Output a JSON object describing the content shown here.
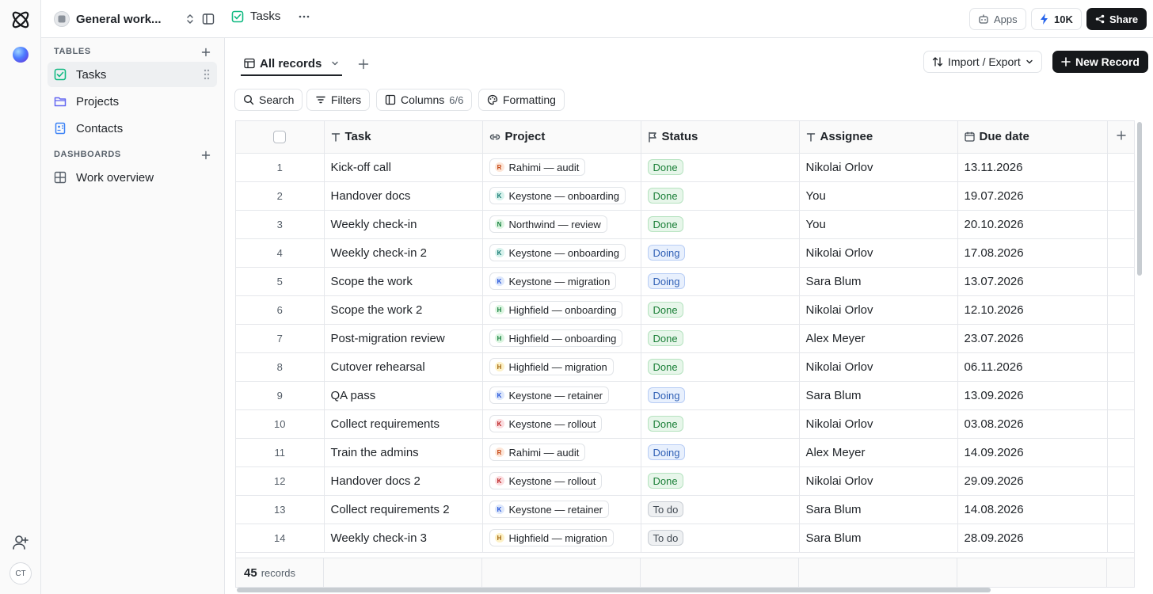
{
  "workspace": {
    "name": "General work..."
  },
  "topbar": {
    "page_title": "Tasks",
    "apps_label": "Apps",
    "credits_label": "10K",
    "share_label": "Share"
  },
  "rail": {
    "avatar_initials": "CT"
  },
  "sidebar": {
    "tables_heading": "TABLES",
    "tables": [
      {
        "label": "Tasks",
        "icon": "checkbox-icon",
        "color": "#10b981"
      },
      {
        "label": "Projects",
        "icon": "folder-icon",
        "color": "#6366f1"
      },
      {
        "label": "Contacts",
        "icon": "contact-book-icon",
        "color": "#3b82f6"
      }
    ],
    "dashboards_heading": "DASHBOARDS",
    "dashboards": [
      {
        "label": "Work overview",
        "icon": "dashboard-grid-icon"
      }
    ]
  },
  "view": {
    "tab_label": "All records"
  },
  "actions": {
    "import_export_label": "Import / Export",
    "new_record_label": "New Record"
  },
  "toolbar": {
    "search_label": "Search",
    "filters_label": "Filters",
    "columns_label": "Columns",
    "columns_count": "6/6",
    "formatting_label": "Formatting"
  },
  "table": {
    "columns": [
      "Task",
      "Project",
      "Status",
      "Assignee",
      "Due date"
    ],
    "rows": [
      {
        "num": "1",
        "task": "Kick-off call",
        "project": "Rahimi — audit",
        "project_initial": "R",
        "status": "Done",
        "assignee": "Nikolai Orlov",
        "due": "13.11.2026"
      },
      {
        "num": "2",
        "task": "Handover docs",
        "project": "Keystone — onboarding",
        "project_initial": "K",
        "status": "Done",
        "assignee": "You",
        "due": "19.07.2026"
      },
      {
        "num": "3",
        "task": "Weekly check-in",
        "project": "Northwind — review",
        "project_initial": "N",
        "status": "Done",
        "assignee": "You",
        "due": "20.10.2026"
      },
      {
        "num": "4",
        "task": "Weekly check-in 2",
        "project": "Keystone — onboarding",
        "project_initial": "K",
        "status": "Doing",
        "assignee": "Nikolai Orlov",
        "due": "17.08.2026"
      },
      {
        "num": "5",
        "task": "Scope the work",
        "project": "Keystone — migration",
        "project_initial": "K",
        "status": "Doing",
        "assignee": "Sara Blum",
        "due": "13.07.2026"
      },
      {
        "num": "6",
        "task": "Scope the work 2",
        "project": "Highfield — onboarding",
        "project_initial": "H",
        "status": "Done",
        "assignee": "Nikolai Orlov",
        "due": "12.10.2026"
      },
      {
        "num": "7",
        "task": "Post-migration review",
        "project": "Highfield — onboarding",
        "project_initial": "H",
        "status": "Done",
        "assignee": "Alex Meyer",
        "due": "23.07.2026"
      },
      {
        "num": "8",
        "task": "Cutover rehearsal",
        "project": "Highfield — migration",
        "project_initial": "H",
        "status": "Done",
        "assignee": "Nikolai Orlov",
        "due": "06.11.2026"
      },
      {
        "num": "9",
        "task": "QA pass",
        "project": "Keystone — retainer",
        "project_initial": "K",
        "status": "Doing",
        "assignee": "Sara Blum",
        "due": "13.09.2026"
      },
      {
        "num": "10",
        "task": "Collect requirements",
        "project": "Keystone — rollout",
        "project_initial": "K",
        "status": "Done",
        "assignee": "Nikolai Orlov",
        "due": "03.08.2026"
      },
      {
        "num": "11",
        "task": "Train the admins",
        "project": "Rahimi — audit",
        "project_initial": "R",
        "status": "Doing",
        "assignee": "Alex Meyer",
        "due": "14.09.2026"
      },
      {
        "num": "12",
        "task": "Handover docs 2",
        "project": "Keystone — rollout",
        "project_initial": "K",
        "status": "Done",
        "assignee": "Nikolai Orlov",
        "due": "29.09.2026"
      },
      {
        "num": "13",
        "task": "Collect requirements 2",
        "project": "Keystone — retainer",
        "project_initial": "K",
        "status": "To do",
        "assignee": "Sara Blum",
        "due": "14.08.2026"
      },
      {
        "num": "14",
        "task": "Weekly check-in 3",
        "project": "Highfield — migration",
        "project_initial": "H",
        "status": "To do",
        "assignee": "Sara Blum",
        "due": "28.09.2026"
      }
    ],
    "record_count": "45",
    "record_label": "records"
  },
  "colors": {
    "project_initials": {
      "Rahimi — audit": {
        "bg": "#fde6d8",
        "fg": "#c2410c"
      },
      "Keystone — onboarding": {
        "bg": "#d7f2ec",
        "fg": "#0f766e"
      },
      "Northwind — review": {
        "bg": "#dcf5e1",
        "fg": "#15803d"
      },
      "Keystone — migration": {
        "bg": "#dde7fb",
        "fg": "#1d4ed8"
      },
      "Highfield — onboarding": {
        "bg": "#dcf5e1",
        "fg": "#15803d"
      },
      "Highfield — migration": {
        "bg": "#fdf1c7",
        "fg": "#a16207"
      },
      "Keystone — retainer": {
        "bg": "#dde7fb",
        "fg": "#1d4ed8"
      },
      "Keystone — rollout": {
        "bg": "#fbdcdf",
        "fg": "#b91c1c"
      }
    }
  }
}
